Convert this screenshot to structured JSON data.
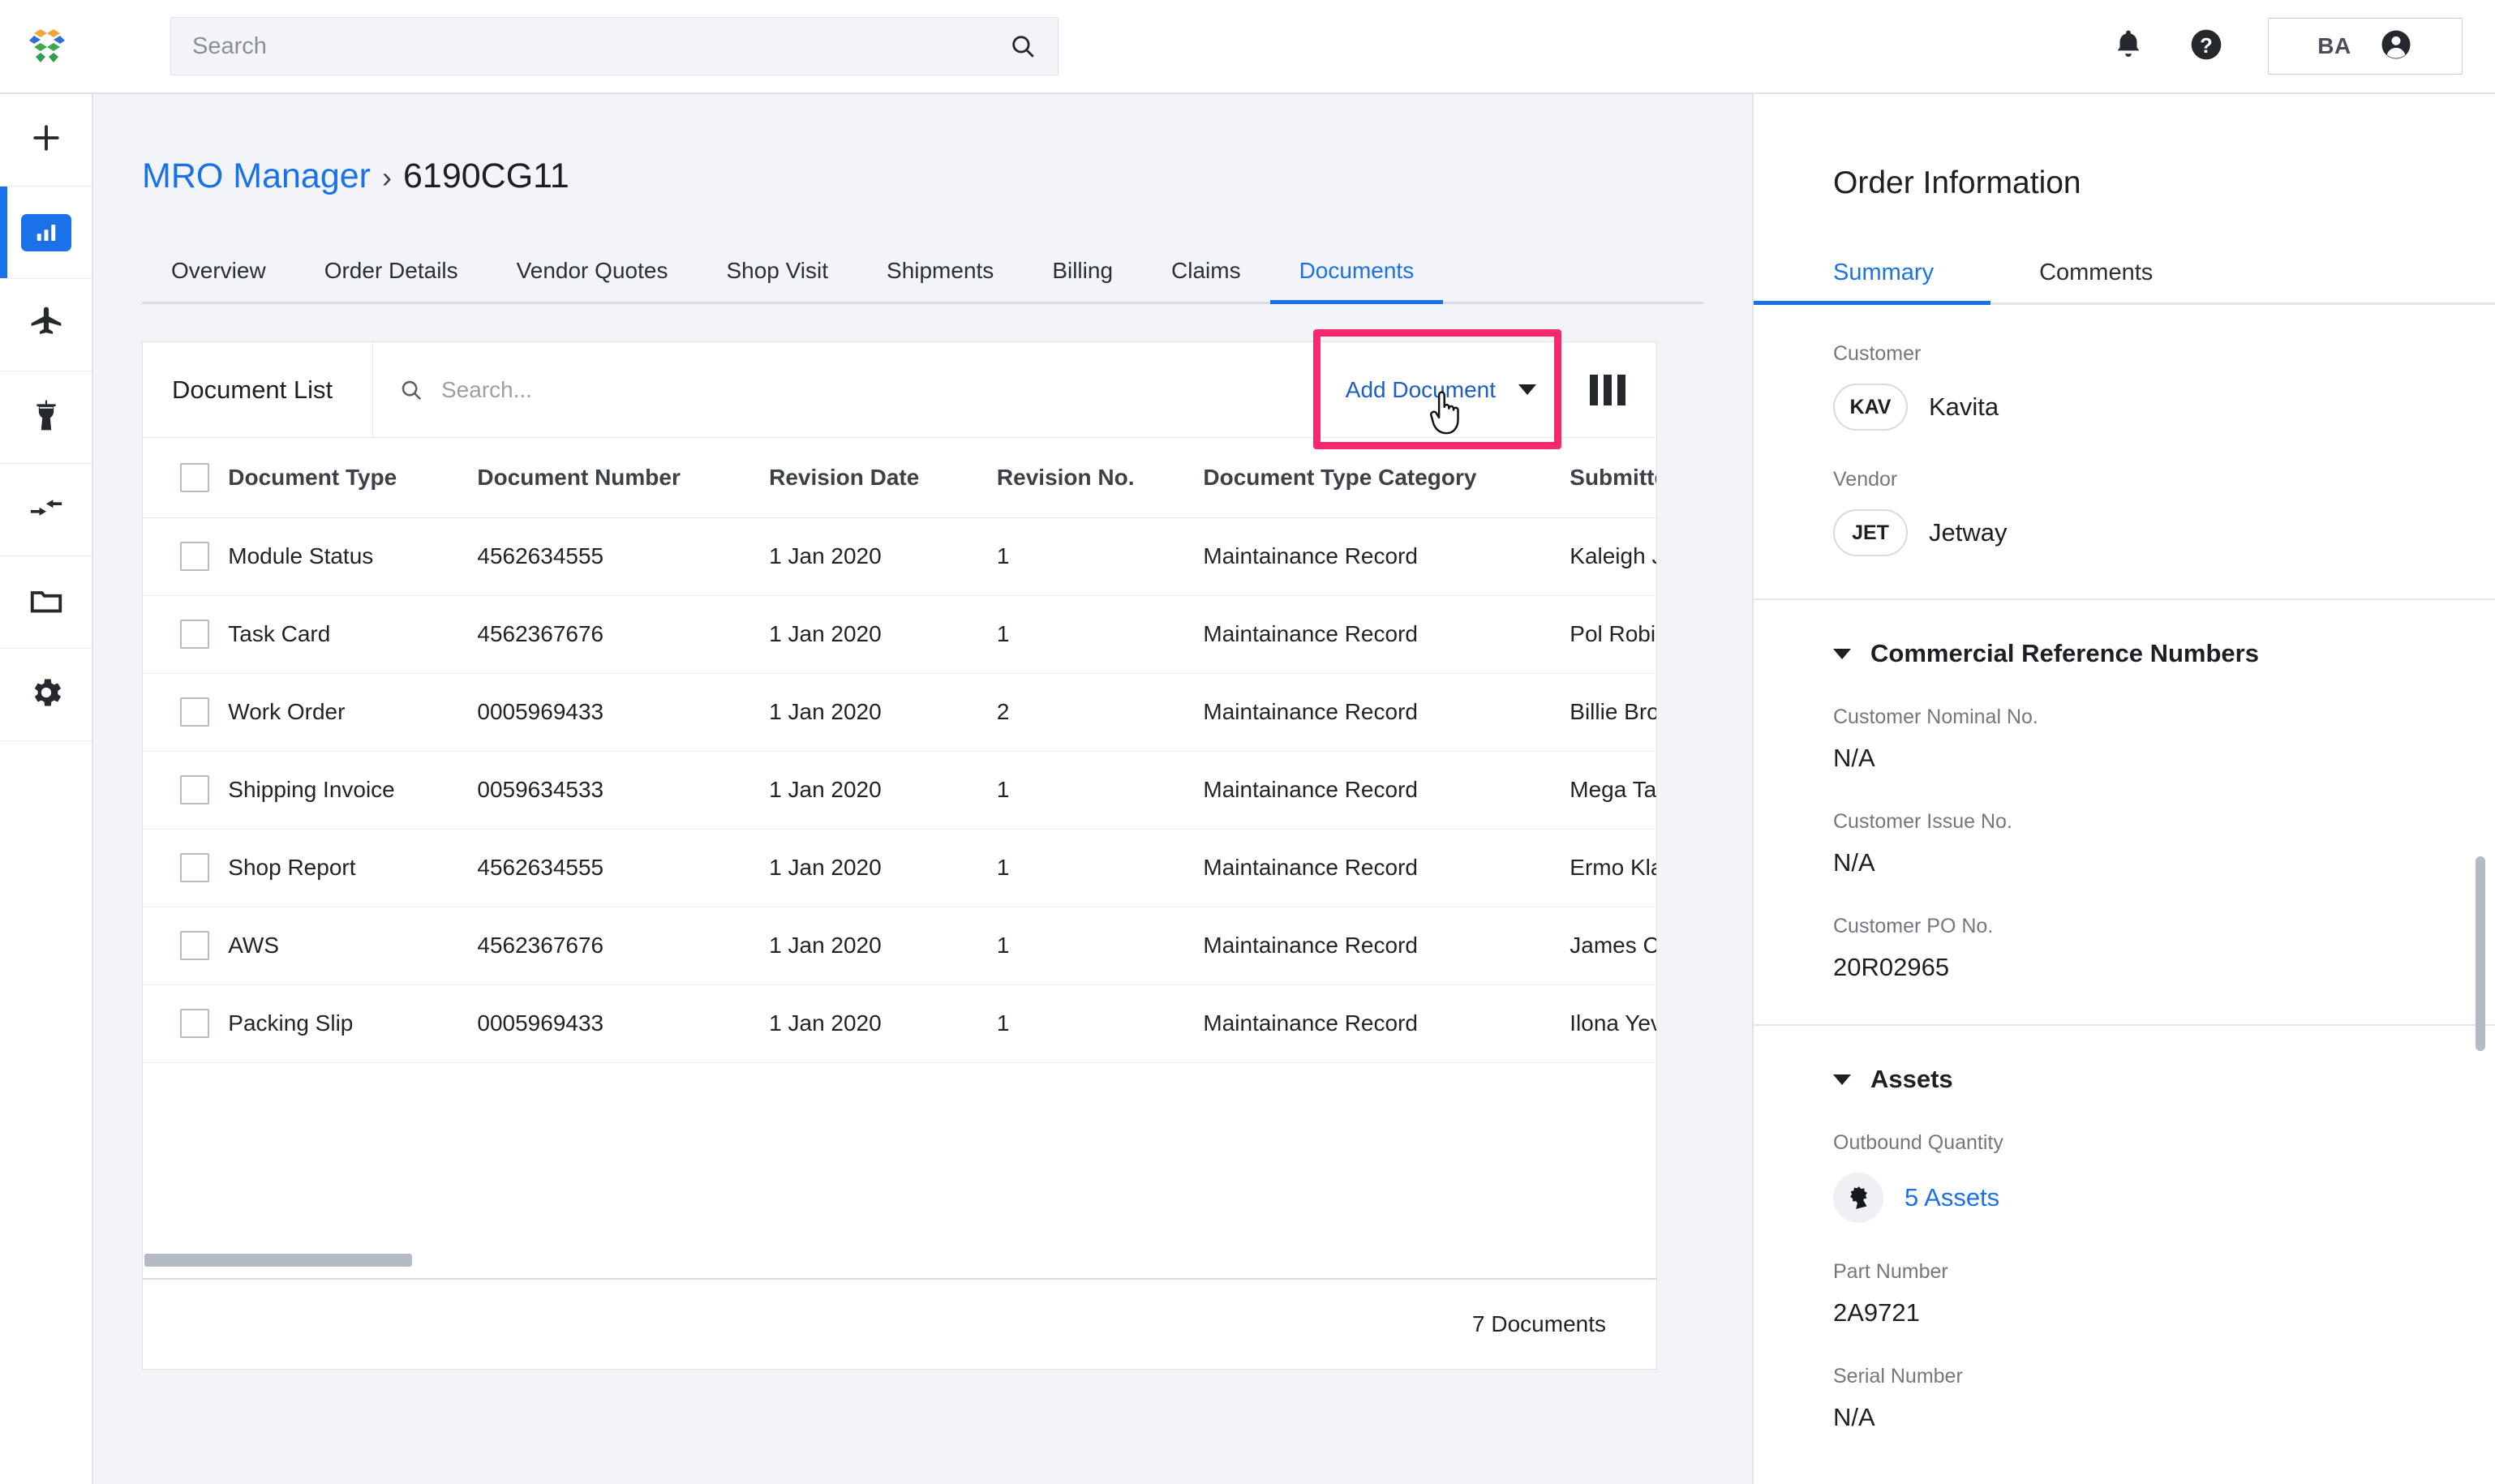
{
  "header": {
    "logo_icon": "company-hexagon-logo",
    "search_placeholder": "Search",
    "search_value": "",
    "search_icon": "search-icon",
    "notifications_icon": "bell-icon",
    "help_icon": "question-circle-icon",
    "user_initials": "BA",
    "user_icon": "account-circle-icon"
  },
  "rail": {
    "items": [
      {
        "name": "add",
        "icon": "plus-icon",
        "active": false
      },
      {
        "name": "dashboard",
        "icon": "bar-chart-icon",
        "active": true
      },
      {
        "name": "fleet",
        "icon": "airplane-icon",
        "active": false
      },
      {
        "name": "tower",
        "icon": "control-tower-icon",
        "active": false
      },
      {
        "name": "transfers",
        "icon": "arrows-transfer-icon",
        "active": false
      },
      {
        "name": "folders",
        "icon": "folder-icon",
        "active": false
      },
      {
        "name": "settings",
        "icon": "gear-icon",
        "active": false
      }
    ]
  },
  "breadcrumb": {
    "root": "MRO Manager",
    "separator": "›",
    "current": "6190CG11"
  },
  "tabs": [
    {
      "label": "Overview",
      "active": false
    },
    {
      "label": "Order Details",
      "active": false
    },
    {
      "label": "Vendor Quotes",
      "active": false
    },
    {
      "label": "Shop Visit",
      "active": false
    },
    {
      "label": "Shipments",
      "active": false
    },
    {
      "label": "Billing",
      "active": false
    },
    {
      "label": "Claims",
      "active": false
    },
    {
      "label": "Documents",
      "active": true
    }
  ],
  "document_list": {
    "title": "Document List",
    "search_placeholder": "Search...",
    "search_value": "",
    "search_icon": "search-icon",
    "add_document_label": "Add Document",
    "add_document_caret": "chevron-down-icon",
    "add_document_highlight_color": "#f6296e",
    "columns_icon": "column-settings-icon",
    "cursor_icon": "pointer-hand-cursor",
    "columns": [
      "Document Type",
      "Document Number",
      "Revision Date",
      "Revision No.",
      "Document Type Category",
      "Submitted by"
    ],
    "rows": [
      {
        "document_type": "Module Status",
        "document_number": "4562634555",
        "revision_date": "1 Jan 2020",
        "revision_no": "1",
        "category": "Maintainance Record",
        "submitted_by": "Kaleigh Jasna (KAVITA)"
      },
      {
        "document_type": "Task Card",
        "document_number": "4562367676",
        "revision_date": "1 Jan 2020",
        "revision_no": "1",
        "category": "Maintainance Record",
        "submitted_by": "Pol Robin (KAVITA)"
      },
      {
        "document_type": "Work Order",
        "document_number": "0005969433",
        "revision_date": "1 Jan 2020",
        "revision_no": "2",
        "category": "Maintainance Record",
        "submitted_by": "Billie Brock (KAVITA)"
      },
      {
        "document_type": "Shipping Invoice",
        "document_number": "0059634533",
        "revision_date": "1 Jan 2020",
        "revision_no": "1",
        "category": "Maintainance Record",
        "submitted_by": "Mega Tau (KAVITA)"
      },
      {
        "document_type": "Shop Report",
        "document_number": "4562634555",
        "revision_date": "1 Jan 2020",
        "revision_no": "1",
        "category": "Maintainance Record",
        "submitted_by": "Ermo Klaes (KAVITA)"
      },
      {
        "document_type": "AWS",
        "document_number": "4562367676",
        "revision_date": "1 Jan 2020",
        "revision_no": "1",
        "category": "Maintainance Record",
        "submitted_by": "James Chang (KAVITA)"
      },
      {
        "document_type": "Packing Slip",
        "document_number": "0005969433",
        "revision_date": "1 Jan 2020",
        "revision_no": "1",
        "category": "Maintainance Record",
        "submitted_by": "Ilona Yeva (KAVITA)"
      }
    ],
    "footer_count": "7 Documents"
  },
  "order_info": {
    "title": "Order Information",
    "tabs": [
      {
        "label": "Summary",
        "active": true
      },
      {
        "label": "Comments",
        "active": false
      }
    ],
    "customer_label": "Customer",
    "customer_chip": "KAV",
    "customer_name": "Kavita",
    "vendor_label": "Vendor",
    "vendor_chip": "JET",
    "vendor_name": "Jetway",
    "commercial_group": {
      "title": "Commercial Reference Numbers",
      "fields": [
        {
          "label": "Customer Nominal No.",
          "value": "N/A"
        },
        {
          "label": "Customer Issue No.",
          "value": "N/A"
        },
        {
          "label": "Customer PO No.",
          "value": "20R02965"
        }
      ]
    },
    "assets_group": {
      "title": "Assets",
      "outbound_quantity_label": "Outbound Quantity",
      "assets_icon": "engine-part-icon",
      "assets_link": "5 Assets",
      "part_number_label": "Part Number",
      "part_number_value": "2A9721",
      "serial_number_label": "Serial Number",
      "serial_number_value": "N/A"
    }
  },
  "colors": {
    "accent_blue": "#1b72e8",
    "highlight_pink": "#f6296e",
    "page_bg": "#f2f4f8"
  }
}
